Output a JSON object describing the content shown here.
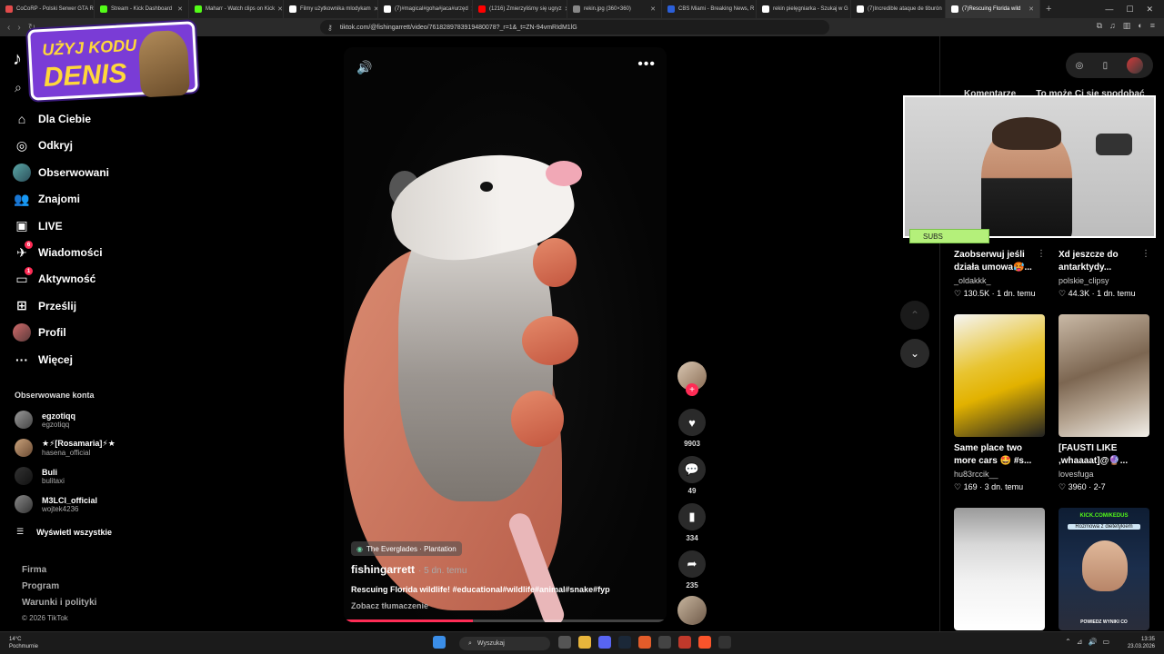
{
  "browser": {
    "tabs": [
      {
        "label": "CoCoRP - Polski Serwer GTA RP",
        "color": "#e24b4b"
      },
      {
        "label": "Stream - Kick Dashboard",
        "color": "#53fc18"
      },
      {
        "label": "Maharr - Watch clips on Kick",
        "color": "#53fc18"
      },
      {
        "label": "Filmy użytkownika mlodykam",
        "color": "#ffffff"
      },
      {
        "label": "(7)#magical#goha#jaca#urzęd",
        "color": "#ffffff"
      },
      {
        "label": "(1216) Zmierzyliśmy się ugryz",
        "color": "#ff0000"
      },
      {
        "label": "rekin.jpg (360×360)",
        "color": "#888888"
      },
      {
        "label": "CBS Miami - Breaking News, R",
        "color": "#2b5fd9"
      },
      {
        "label": "rekin pielęgniarka - Szukaj w G",
        "color": "#ffffff"
      },
      {
        "label": "(7)Incredible ataque de tiburón",
        "color": "#ffffff"
      },
      {
        "label": "(7)Rescuing Florida wild",
        "color": "#ffffff",
        "active": true
      }
    ],
    "url": "tiktok.com/@fishingarrett/video/7618289783919480078?_r=1&_t=ZN-94vmRIdM1lG"
  },
  "promo": {
    "line1": "UŻYJ KODU",
    "line2": "DENIS"
  },
  "sidebar": {
    "nav": [
      {
        "label": "Dla Ciebie",
        "icon": "home-icon",
        "glyph": "⌂"
      },
      {
        "label": "Odkryj",
        "icon": "compass-icon",
        "glyph": "◎"
      },
      {
        "label": "Obserwowani",
        "icon": "following-avatar-icon",
        "glyph": "●"
      },
      {
        "label": "Znajomi",
        "icon": "friends-icon",
        "glyph": "👥"
      },
      {
        "label": "LIVE",
        "icon": "live-icon",
        "glyph": "▣"
      },
      {
        "label": "Wiadomości",
        "icon": "messages-icon",
        "glyph": "✈",
        "badge": "6"
      },
      {
        "label": "Aktywność",
        "icon": "activity-icon",
        "glyph": "▭",
        "badge": "1"
      },
      {
        "label": "Prześlij",
        "icon": "upload-icon",
        "glyph": "⊞"
      },
      {
        "label": "Profil",
        "icon": "profile-avatar-icon",
        "glyph": "●"
      },
      {
        "label": "Więcej",
        "icon": "more-icon",
        "glyph": "···"
      }
    ],
    "following_title": "Obserwowane konta",
    "following": [
      {
        "name": "egzotiqq",
        "handle": "egzotiqq"
      },
      {
        "name": "★⚡[Rosamaria]⚡★",
        "handle": "hasena_official"
      },
      {
        "name": "Buli",
        "handle": "bulitaxi"
      },
      {
        "name": "M3LCI_official",
        "handle": "wojtek4236"
      }
    ],
    "show_all": "Wyświetl wszystkie",
    "footer": [
      "Firma",
      "Program",
      "Warunki i polityki"
    ],
    "copyright": "© 2026 TikTok"
  },
  "video": {
    "location": "The Everglades · Plantation",
    "author": "fishingarrett",
    "time": "· 5 dn. temu",
    "caption": "Rescuing Florida wildlife! #educational#wildlife#animal#snake#fyp",
    "translate": "Zobacz tłumaczenie",
    "progress": 0.4
  },
  "actions": {
    "likes": "9903",
    "comments": "49",
    "saves": "334",
    "shares": "235"
  },
  "right_panel": {
    "tabs": [
      "Komentarze",
      "To może Ci się spodobać"
    ],
    "subs_label": "SUBS",
    "top_cards": [
      {
        "title": "Zaobserwuj jeśli działa umowa🥵...",
        "author": "_oldakkk_",
        "meta": "♡ 130.5K · 1 dn. temu"
      },
      {
        "title": "Xd jeszcze do antarktydy...",
        "author": "polskie_clipsy",
        "meta": "♡ 44.3K · 1 dn. temu"
      }
    ],
    "cards": [
      {
        "title": "Same place two more cars 🤩 #s...",
        "author": "hu83rccik__",
        "meta": "♡ 169 · 3 dn. temu"
      },
      {
        "title": "[FAUSTI LIKE ,whaaaat]@🔮...",
        "author": "lovesfuga",
        "meta": "♡ 3960 · 2-7"
      }
    ],
    "bottom_thumb_text": [
      "KICK.COM/KEDUS",
      "Rozmowa z dietetykiem",
      "POWIEDZ WYNIKI CO"
    ]
  },
  "taskbar": {
    "weather_temp": "14°C",
    "weather_desc": "Pochmurnie",
    "search": "Wyszukaj",
    "time": "13:35",
    "date": "23.03.2026"
  }
}
